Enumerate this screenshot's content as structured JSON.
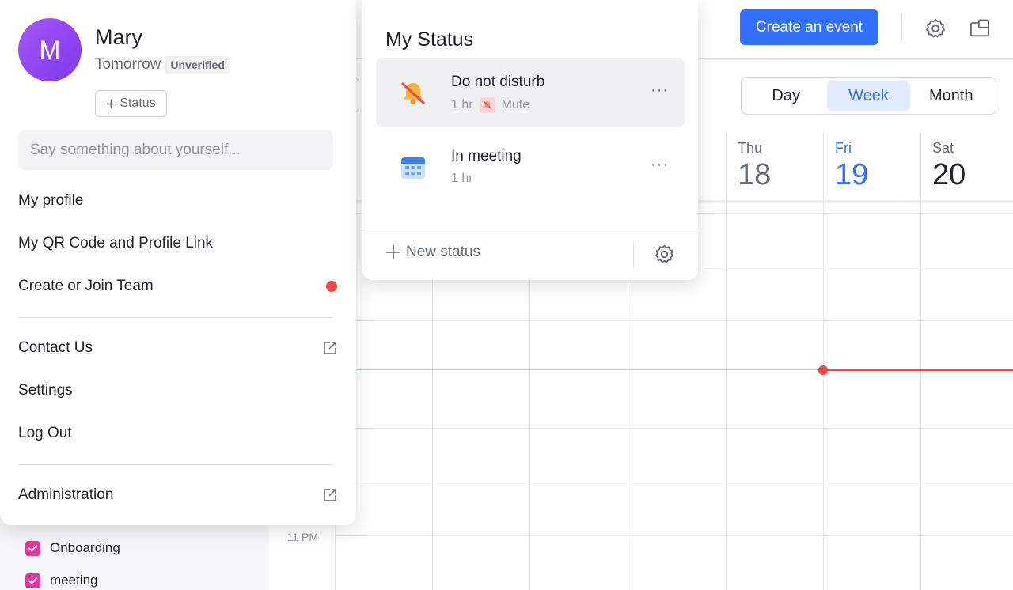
{
  "profile": {
    "avatar_initial": "M",
    "name": "Mary",
    "time_label": "Tomorrow",
    "verification_badge": "Unverified",
    "status_button": "Status",
    "about_placeholder": "Say something about yourself...",
    "menu": {
      "my_profile": "My profile",
      "qr_code": "My QR Code and Profile Link",
      "create_team": "Create or Join Team",
      "contact_us": "Contact Us",
      "settings": "Settings",
      "log_out": "Log Out",
      "administration": "Administration"
    },
    "notification_dot_color": "#f54a45",
    "avatar_color": "#8b3df0"
  },
  "status_panel": {
    "title": "My Status",
    "items": [
      {
        "name": "Do not disturb",
        "duration": "1 hr",
        "extra": "Mute",
        "icon": "bell-off-icon"
      },
      {
        "name": "In meeting",
        "duration": "1 hr",
        "icon": "calendar-icon"
      }
    ],
    "more_label": "···",
    "new_status": "New status"
  },
  "calendar": {
    "create_button": "Create an event",
    "accent_color": "#3370ff",
    "views": [
      "Day",
      "Week",
      "Month"
    ],
    "active_view": "Week",
    "days": [
      {
        "name": "Thu",
        "num": "18"
      },
      {
        "name": "Fri",
        "num": "19"
      },
      {
        "name": "Sat",
        "num": "20"
      }
    ],
    "today": "Fri",
    "time_labels": [
      "11 PM"
    ],
    "calendars": [
      {
        "name": "Onboarding",
        "checked": true
      },
      {
        "name": "meeting",
        "checked": true
      }
    ]
  }
}
